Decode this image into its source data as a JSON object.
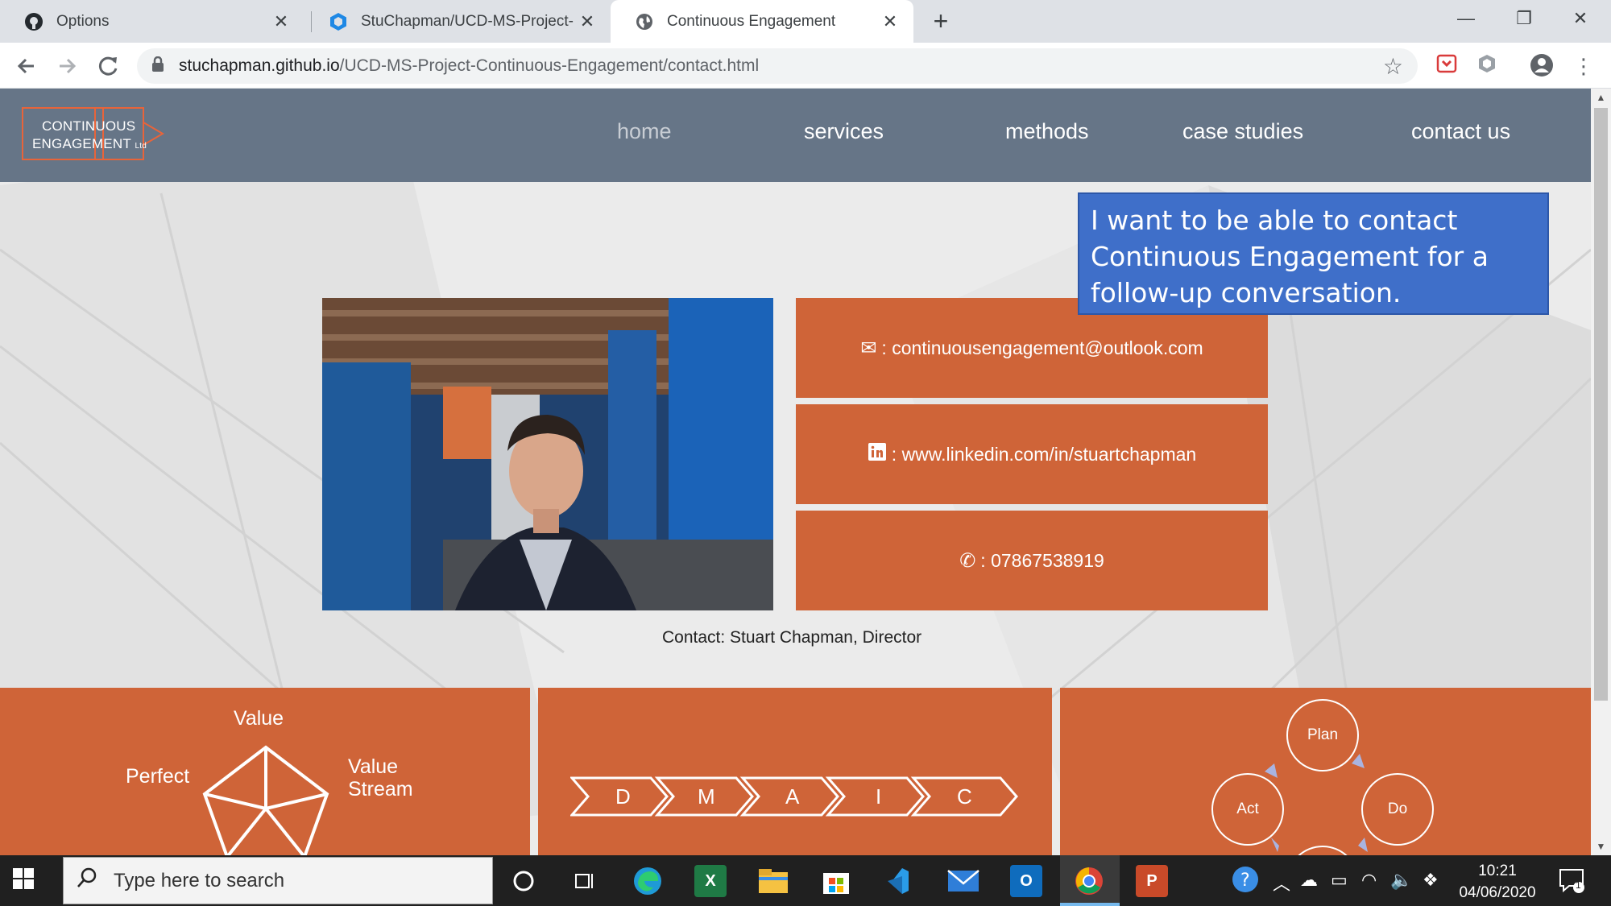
{
  "browser": {
    "tabs": [
      {
        "title": "Options",
        "icon": "github-icon",
        "active": false
      },
      {
        "title": "StuChapman/UCD-MS-Project-C",
        "icon": "codeanywhere-icon",
        "active": false
      },
      {
        "title": "Continuous Engagement",
        "icon": "globe-icon",
        "active": true
      }
    ],
    "url_host": "stuchapman.github.io",
    "url_path": "/UCD-MS-Project-Continuous-Engagement/contact.html"
  },
  "site": {
    "logo_line1": "CONTINUOUS",
    "logo_line2": "ENGAGEMENT",
    "logo_suffix": "Ltd",
    "nav": {
      "home": "home",
      "services": "services",
      "methods": "methods",
      "case_studies": "case studies",
      "contact_us": "contact us"
    },
    "callout": "I want to be able to contact Continuous Engagement for a follow-up conversation.",
    "contacts": {
      "email": ": continuousengagement@outlook.com",
      "linkedin": ": www.linkedin.com/in/stuartchapman",
      "phone": ": 07867538919"
    },
    "caption": "Contact: Stuart Chapman, Director",
    "panel1": {
      "value": "Value",
      "perfect": "Perfect",
      "value_stream_1": "Value",
      "value_stream_2": "Stream"
    },
    "panel2": {
      "letters": [
        "D",
        "M",
        "A",
        "I",
        "C"
      ]
    },
    "panel3": {
      "plan": "Plan",
      "do": "Do",
      "act": "Act"
    }
  },
  "taskbar": {
    "search_placeholder": "Type here to search",
    "time": "10:21",
    "date": "04/06/2020",
    "notifications": "1"
  },
  "colors": {
    "nav_bg": "#667587",
    "accent_orange": "#cf6438",
    "callout_blue": "#3f6fc9"
  }
}
